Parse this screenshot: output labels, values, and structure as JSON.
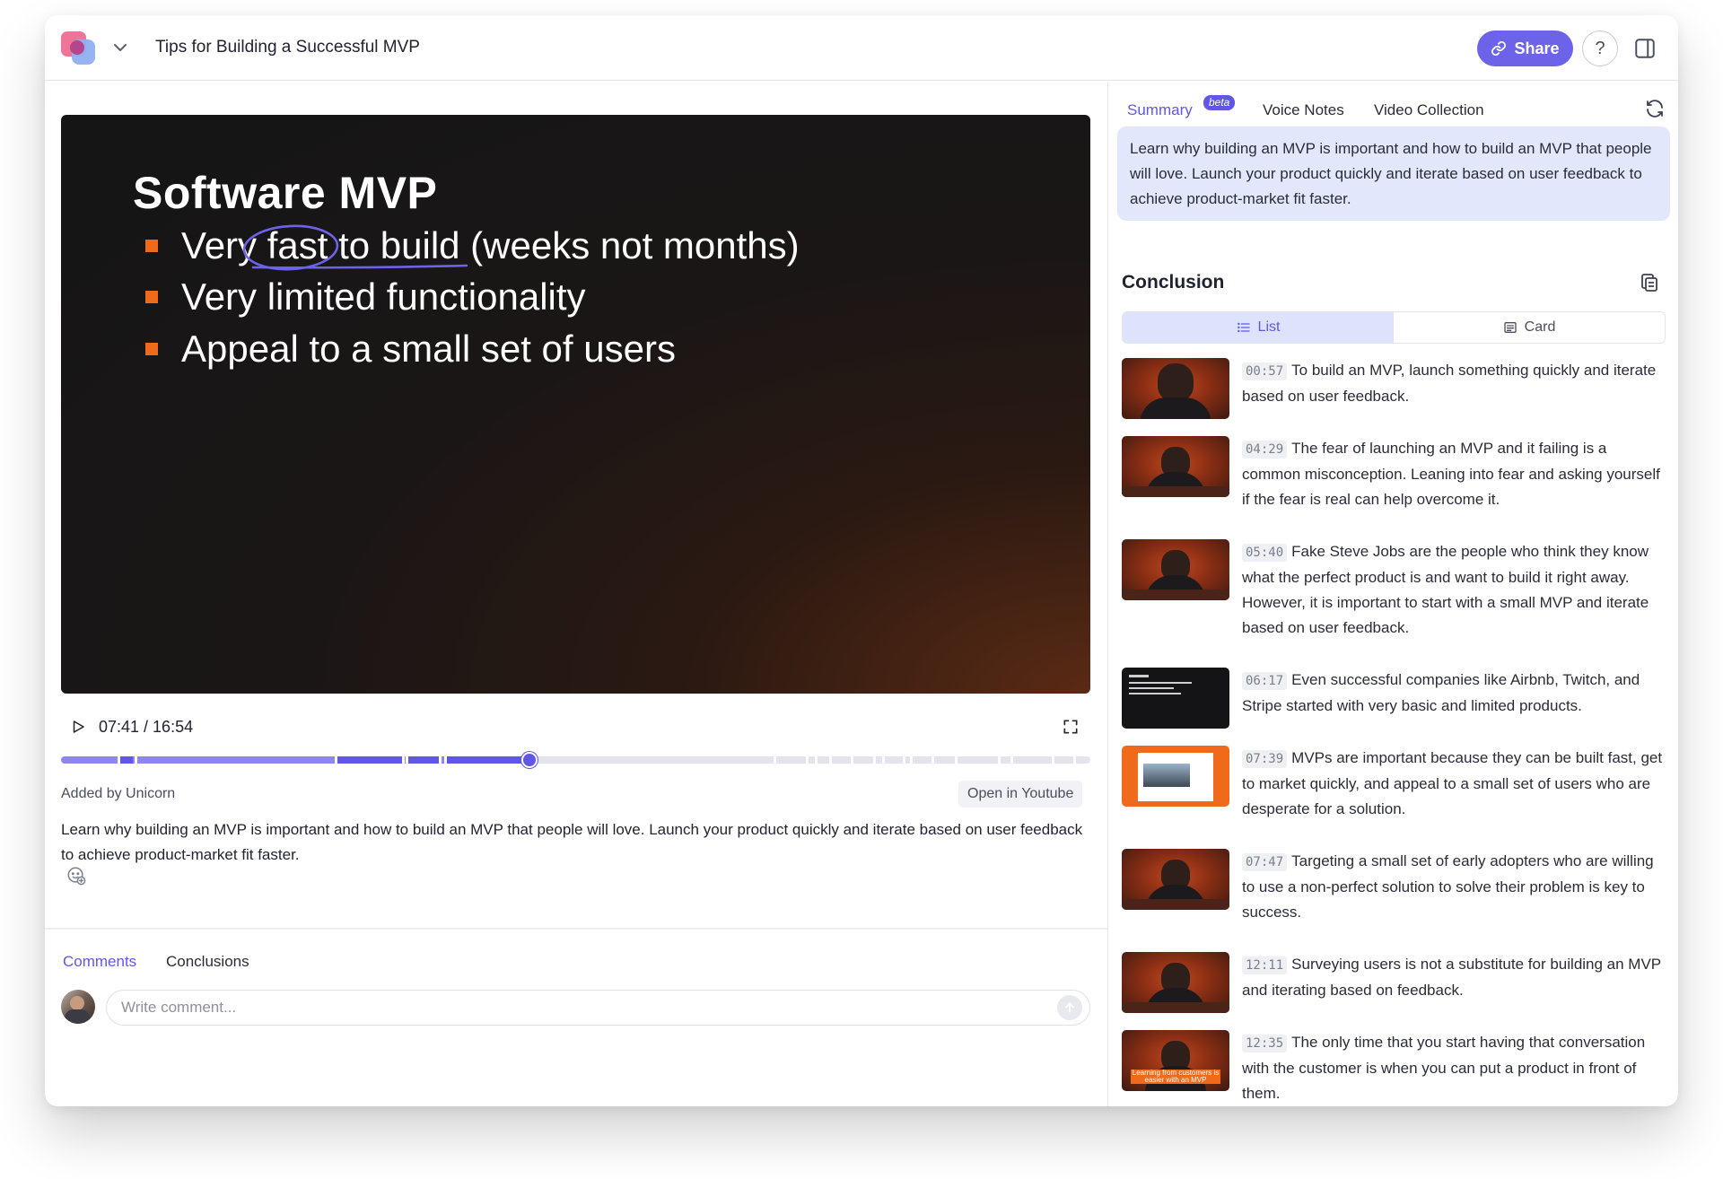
{
  "header": {
    "title": "Tips for Building a Successful MVP",
    "share_label": "Share",
    "help_label": "?"
  },
  "player": {
    "slide_title": "Software MVP",
    "bullets": [
      "Very fast to build (weeks not months)",
      "Very limited functionality",
      "Appeal to a small set of users"
    ],
    "time": "07:41 / 16:54",
    "progress_fraction": 0.455
  },
  "meta": {
    "added_by": "Added by Unicorn",
    "open_youtube": "Open in Youtube",
    "description": "Learn why building an MVP is important and how to build an MVP that people will love. Launch your product quickly and iterate based on user feedback to achieve product-market fit faster."
  },
  "comments": {
    "tabs": [
      "Comments",
      "Conclusions"
    ],
    "placeholder": "Write comment..."
  },
  "sidebar": {
    "tabs": [
      "Summary",
      "Voice Notes",
      "Video Collection"
    ],
    "beta": "beta",
    "summary": "Learn why building an MVP is important and how to build an MVP that people will love. Launch your product quickly and iterate based on user feedback to achieve product-market fit faster.",
    "conclusion_title": "Conclusion",
    "view_list": "List",
    "view_card": "Card",
    "conclusions": [
      {
        "ts": "00:57",
        "text": "To build an MVP, launch something quickly and iterate based on user feedback."
      },
      {
        "ts": "04:29",
        "text": "The fear of launching an MVP and it failing is a common misconception. Leaning into fear and asking yourself if the fear is real can help overcome it."
      },
      {
        "ts": "05:40",
        "text": "Fake Steve Jobs are the people who think they know what the perfect product is and want to build it right away. However, it is important to start with a small MVP and iterate based on user feedback."
      },
      {
        "ts": "06:17",
        "text": "Even successful companies like Airbnb, Twitch, and Stripe started with very basic and limited products."
      },
      {
        "ts": "07:39",
        "text": "MVPs are important because they can be built fast, get to market quickly, and appeal to a small set of users who are desperate for a solution."
      },
      {
        "ts": "07:47",
        "text": "Targeting a small set of early adopters who are willing to use a non-perfect solution to solve their problem is key to success."
      },
      {
        "ts": "12:11",
        "text": "Surveying users is not a substitute for building an MVP and iterating based on feedback."
      },
      {
        "ts": "12:35",
        "text": "The only time that you start having that conversation with the customer is when you can put a product in front of them."
      }
    ],
    "thumb_caption": "Learning from customers is easier with an MVP"
  },
  "colors": {
    "accent": "#6057e6",
    "accent_light": "#8f86f0",
    "slide_bullet": "#f06a1c",
    "summary_bg": "#e3e7fb"
  }
}
